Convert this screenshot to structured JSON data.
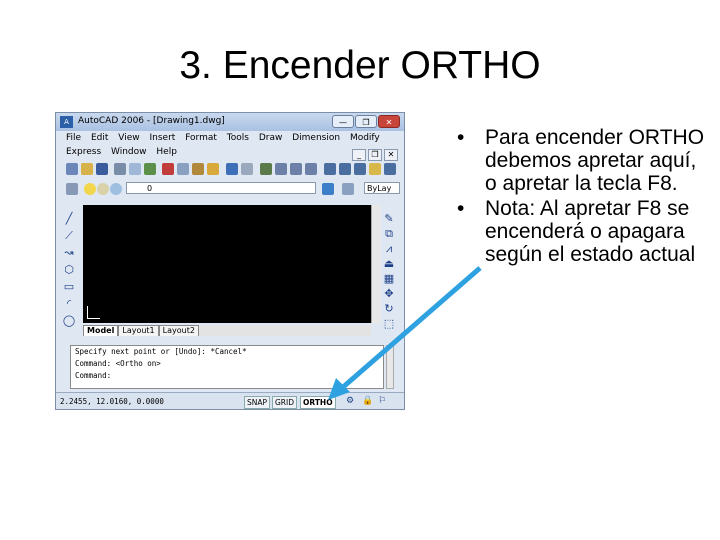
{
  "slide": {
    "title": "3. Encender ORTHO",
    "bullets": [
      "Para encender ORTHO debemos apretar aquí, o apretar la tecla F8.",
      "Nota: Al apretar F8 se encenderá o apagara según el estado actual"
    ]
  },
  "window": {
    "title": "AutoCAD 2006 - [Drawing1.dwg]",
    "app_icon": "A",
    "buttons": {
      "minimize": "—",
      "restore": "❐",
      "close": "✕"
    },
    "menu_row1": [
      "File",
      "Edit",
      "View",
      "Insert",
      "Format",
      "Tools",
      "Draw",
      "Dimension",
      "Modify"
    ],
    "menu_row2": [
      "Express",
      "Window",
      "Help"
    ],
    "mdi_buttons": [
      "_",
      "❐",
      "✕"
    ],
    "layer": {
      "value": "0",
      "bylayer": "ByLay"
    },
    "tabs": [
      "Model",
      "Layout1",
      "Layout2"
    ],
    "command_lines": [
      "Specify next point or [Undo]: *Cancel*",
      "Command: <Ortho on>",
      "Command:"
    ],
    "coords": "2.2455, 12.0160, 0.0000",
    "status_buttons": [
      "SNAP",
      "GRID",
      "ORTHO"
    ],
    "active_status": "ORTHO"
  },
  "colors": {
    "arrow": "#2ea1e0",
    "drawing_bg": "#000000",
    "title_bar": "#b8cde8"
  },
  "icons": {
    "left_tools": [
      "line-icon",
      "xline-icon",
      "polyline-icon",
      "polygon-icon",
      "rectangle-icon",
      "arc-icon",
      "circle-icon"
    ],
    "right_tools": [
      "erase-icon",
      "copy-icon",
      "mirror-icon",
      "offset-icon",
      "array-icon",
      "move-icon",
      "rotate-icon",
      "scale-icon"
    ]
  }
}
